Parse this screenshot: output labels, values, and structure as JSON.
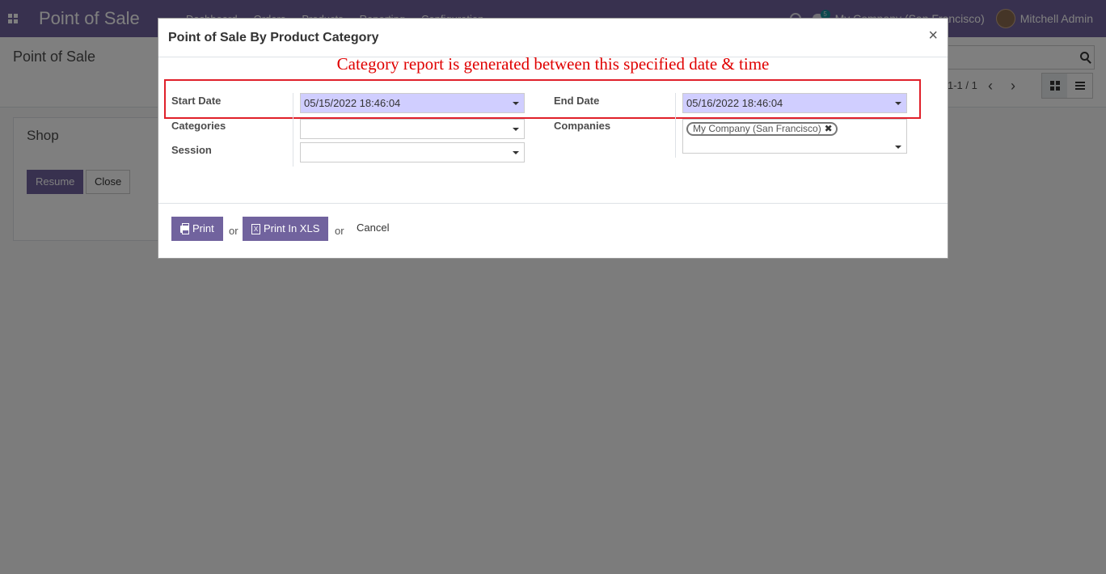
{
  "navbar": {
    "app_title": "Point of Sale",
    "menu": [
      "Dashboard",
      "Orders",
      "Products",
      "Reporting",
      "Configuration"
    ],
    "chat_badge": "5",
    "company": "My Company (San Francisco)",
    "user": "Mitchell Admin"
  },
  "control_panel": {
    "breadcrumb": "Point of Sale",
    "pager": "1-1 / 1"
  },
  "shop_card": {
    "title": "Shop",
    "resume_label": "Resume",
    "close_label": "Close"
  },
  "modal": {
    "title": "Point of Sale By Product Category",
    "close_symbol": "×",
    "annotation": "Category report is generated between this specified date & time",
    "start_date_label": "Start Date",
    "start_date_value": "05/15/2022 18:46:04",
    "end_date_label": "End Date",
    "end_date_value": "05/16/2022 18:46:04",
    "categories_label": "Categories",
    "categories_value": "",
    "companies_label": "Companies",
    "companies_tag": "My Company (San Francisco)",
    "session_label": "Session",
    "session_value": "",
    "print_label": "Print",
    "or_label": "or",
    "print_xls_label": "Print In XLS",
    "cancel_label": "Cancel"
  },
  "colors": {
    "brand": "#71639e",
    "date_field_bg": "#d0ceff",
    "annotation_red": "#e00000"
  }
}
